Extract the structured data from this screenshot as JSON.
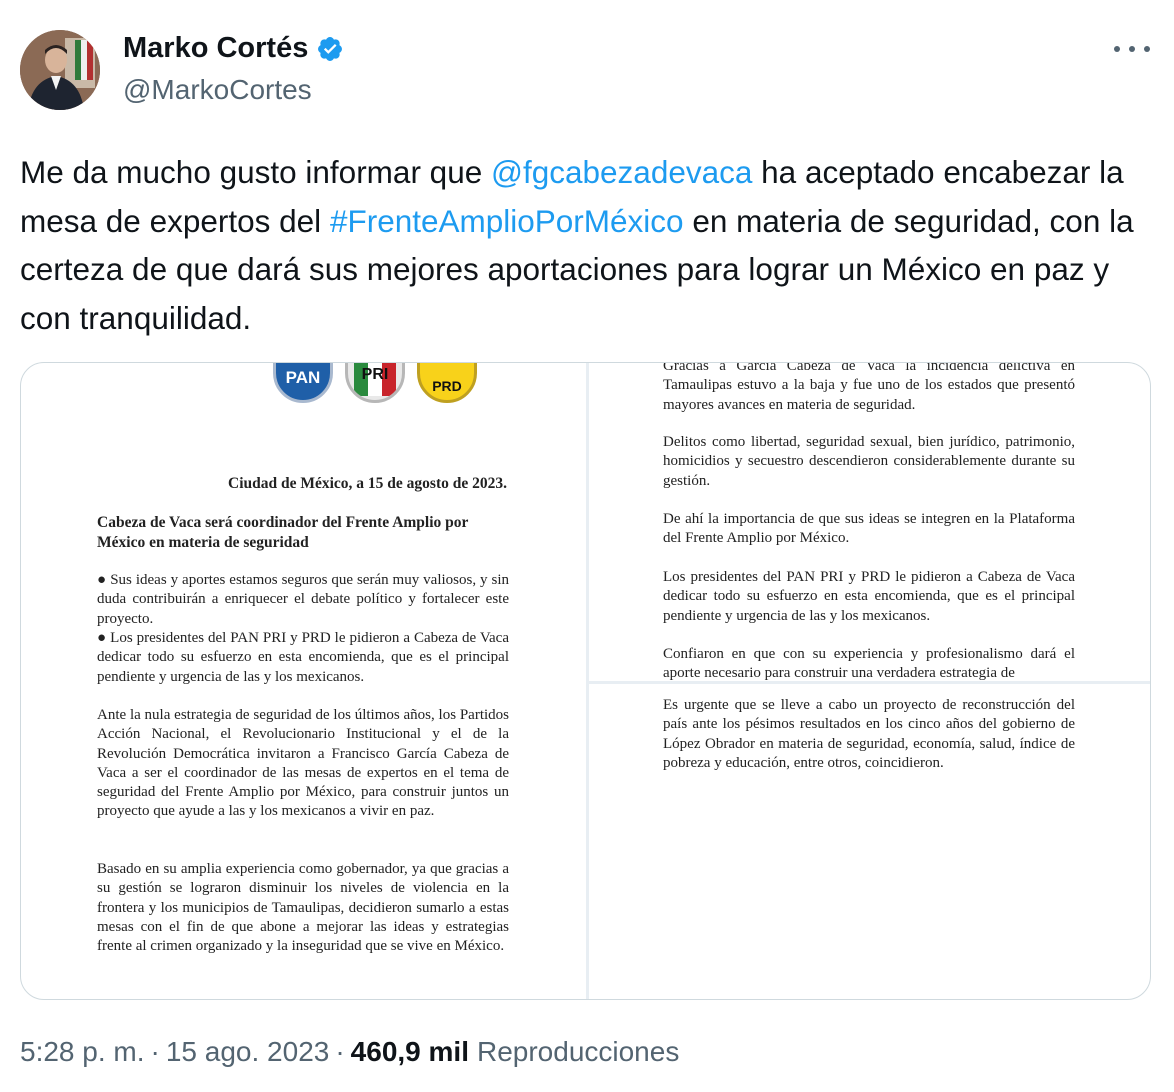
{
  "author": {
    "display_name": "Marko Cortés",
    "handle": "@MarkoCortes"
  },
  "tweet": {
    "text_1": "Me da mucho gusto informar que ",
    "mention": "@fgcabezadevaca",
    "text_2": " ha aceptado encabezar la mesa de expertos del ",
    "hashtag": "#FrenteAmplioPorMéxico",
    "text_3": " en materia de seguridad, con la certeza de que dará sus mejores aportaciones para lograr un México en paz y con tranquilidad."
  },
  "document_left": {
    "logos": [
      "PAN",
      "PRI",
      "PRD"
    ],
    "date_line": "Ciudad de México, a 15 de agosto de 2023.",
    "title": "Cabeza de Vaca será coordinador del Frente Amplio por México en materia de seguridad",
    "bullet_1": "● Sus ideas y aportes estamos seguros que serán muy valiosos, y sin duda contribuirán a enriquecer el debate político y fortalecer este proyecto.",
    "bullet_2": "● Los presidentes del PAN PRI y PRD le pidieron a Cabeza de Vaca dedicar todo su esfuerzo en esta encomienda, que es el principal pendiente y urgencia de las y los mexicanos.",
    "paragraph_1": "Ante la nula estrategia de seguridad de los últimos años, los Partidos Acción Nacional, el Revolucionario Institucional y el de la Revolución Democrática invitaron a Francisco García Cabeza de Vaca a ser el coordinador de las mesas de expertos en el tema de seguridad del Frente Amplio por México, para construir juntos un proyecto que ayude a las y los mexicanos a vivir en paz.",
    "paragraph_2": "Basado en su amplia experiencia como gobernador, ya que gracias a su gestión se lograron disminuir los niveles de violencia en la frontera y los municipios de Tamaulipas, decidieron sumarlo a estas mesas con el fin de que abone a mejorar las ideas y estrategias frente al crimen organizado y la inseguridad que se vive en México."
  },
  "document_right_top": {
    "paragraph_1": "Gracias a García Cabeza de Vaca la incidencia delictiva en Tamaulipas estuvo a la baja y fue uno de los estados que presentó mayores avances en materia de seguridad.",
    "paragraph_2": "Delitos como libertad, seguridad sexual, bien jurídico, patrimonio, homicidios y secuestro descendieron considerablemente durante su gestión.",
    "paragraph_3": "De ahí la importancia de que sus ideas se integren en la Plataforma del Frente Amplio por México.",
    "paragraph_4": "Los presidentes del PAN PRI y PRD le pidieron a Cabeza de Vaca dedicar todo su esfuerzo en esta encomienda, que es el principal pendiente y urgencia de las y los mexicanos.",
    "paragraph_5": "Confiaron en que con su experiencia y profesionalismo dará el aporte necesario para construir una verdadera estrategia de"
  },
  "document_right_bottom": {
    "paragraph_1": "Es urgente que se lleve a cabo un proyecto de reconstrucción del país ante los pésimos resultados en los cinco años del gobierno de López Obrador en materia de seguridad, economía, salud, índice de pobreza y educación, entre otros, coincidieron."
  },
  "footer": {
    "time": "5:28 p. m.",
    "separator": "·",
    "date": "15 ago. 2023",
    "views_count": "460,9 mil",
    "views_label": "Reproducciones"
  },
  "colors": {
    "link": "#1d9bf0",
    "verified": "#1d9bf0",
    "secondary_text": "#536471"
  }
}
